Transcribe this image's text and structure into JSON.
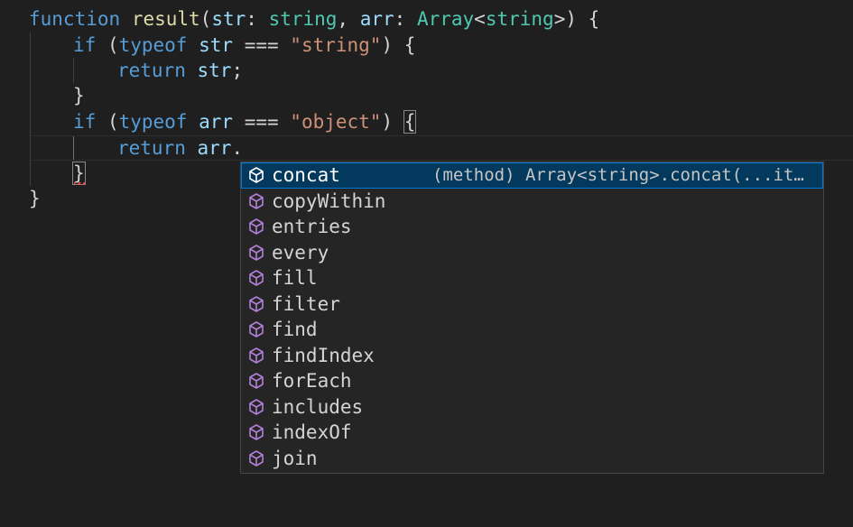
{
  "code": {
    "line1": {
      "kw": "function",
      "name": "result",
      "p1": "str",
      "t1": "string",
      "p2": "arr",
      "t2": "Array",
      "t2arg": "string"
    },
    "line2": {
      "kw": "if",
      "op": "typeof",
      "var": "str",
      "cmp": "===",
      "str": "\"string\""
    },
    "line3": {
      "kw": "return",
      "var": "str"
    },
    "line5": {
      "kw": "if",
      "op": "typeof",
      "var": "arr",
      "cmp": "===",
      "str": "\"object\""
    },
    "line6": {
      "kw": "return",
      "var": "arr"
    }
  },
  "suggest": {
    "items": [
      {
        "label": "concat",
        "detail": "(method) Array<string>.concat(...items:…"
      },
      {
        "label": "copyWithin"
      },
      {
        "label": "entries"
      },
      {
        "label": "every"
      },
      {
        "label": "fill"
      },
      {
        "label": "filter"
      },
      {
        "label": "find"
      },
      {
        "label": "findIndex"
      },
      {
        "label": "forEach"
      },
      {
        "label": "includes"
      },
      {
        "label": "indexOf"
      },
      {
        "label": "join"
      }
    ],
    "icon": "method-cube-icon",
    "icon_color": "#b180d7",
    "selected_icon_color": "#ffffff"
  }
}
